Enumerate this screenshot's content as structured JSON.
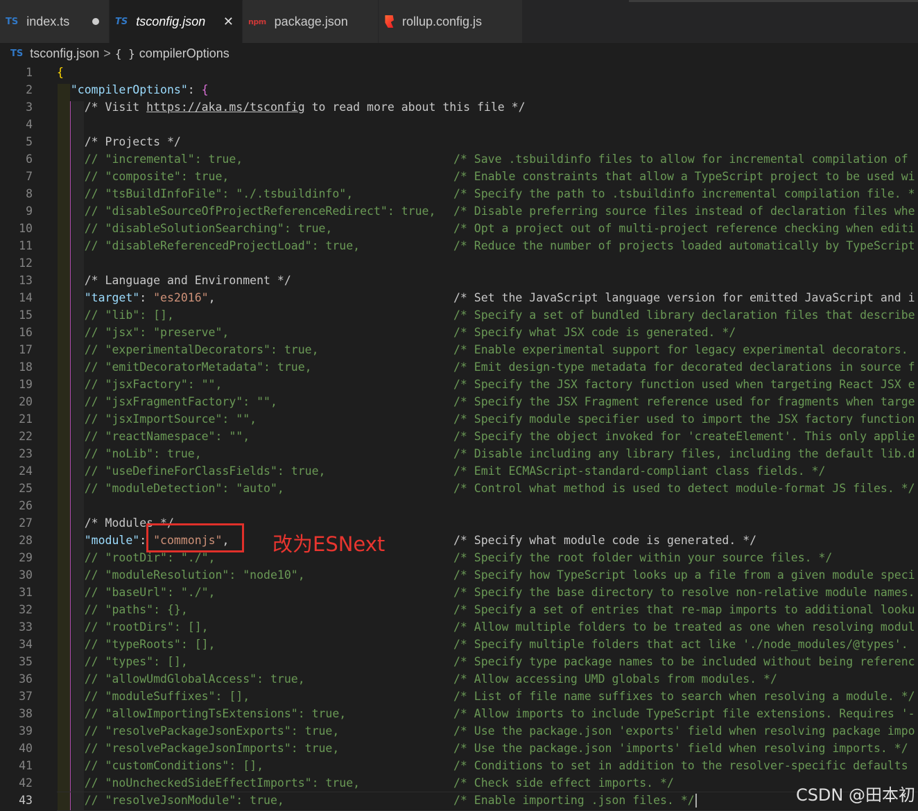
{
  "tabs": [
    {
      "icon": "TS",
      "label": "index.ts",
      "state": "modified"
    },
    {
      "icon": "TS",
      "label": "tsconfig.json",
      "state": "active"
    },
    {
      "icon": "npm",
      "label": "package.json",
      "state": ""
    },
    {
      "icon": "rollup",
      "label": "rollup.config.js",
      "state": ""
    }
  ],
  "breadcrumb": {
    "file": "tsconfig.json",
    "separator": ">",
    "symbol_icon": "{ }",
    "symbol": "compilerOptions"
  },
  "editor": {
    "current_line": 43,
    "lines": [
      {
        "n": "1",
        "code": [
          [
            "tk-brace",
            "{"
          ]
        ],
        "comment": ""
      },
      {
        "n": "2",
        "code": [
          [
            "tk-pun",
            "  "
          ],
          [
            "tk-key",
            "\"compilerOptions\""
          ],
          [
            "tk-pun",
            ": "
          ],
          [
            "tk-brace2",
            "{"
          ]
        ],
        "comment": ""
      },
      {
        "n": "3",
        "code": [
          [
            "tk-pun",
            "    "
          ],
          [
            "tk-gray",
            "/* Visit "
          ],
          [
            "tk-link",
            "https://aka.ms/tsconfig"
          ],
          [
            "tk-gray",
            " to read more about this file */"
          ]
        ],
        "comment": ""
      },
      {
        "n": "4",
        "code": [],
        "comment": ""
      },
      {
        "n": "5",
        "code": [
          [
            "tk-pun",
            "    "
          ],
          [
            "tk-gray",
            "/* Projects */"
          ]
        ],
        "comment": ""
      },
      {
        "n": "6",
        "code": [
          [
            "tk-pun",
            "    "
          ],
          [
            "tk-com",
            "// \"incremental\": true,"
          ]
        ],
        "comment": "/* Save .tsbuildinfo files to allow for incremental compilation of"
      },
      {
        "n": "7",
        "code": [
          [
            "tk-pun",
            "    "
          ],
          [
            "tk-com",
            "// \"composite\": true,"
          ]
        ],
        "comment": "/* Enable constraints that allow a TypeScript project to be used wi"
      },
      {
        "n": "8",
        "code": [
          [
            "tk-pun",
            "    "
          ],
          [
            "tk-com",
            "// \"tsBuildInfoFile\": \"./.tsbuildinfo\","
          ]
        ],
        "comment": "/* Specify the path to .tsbuildinfo incremental compilation file. *"
      },
      {
        "n": "9",
        "code": [
          [
            "tk-pun",
            "    "
          ],
          [
            "tk-com",
            "// \"disableSourceOfProjectReferenceRedirect\": true,"
          ]
        ],
        "comment": "/* Disable preferring source files instead of declaration files whe"
      },
      {
        "n": "10",
        "code": [
          [
            "tk-pun",
            "    "
          ],
          [
            "tk-com",
            "// \"disableSolutionSearching\": true,"
          ]
        ],
        "comment": "/* Opt a project out of multi-project reference checking when editi"
      },
      {
        "n": "11",
        "code": [
          [
            "tk-pun",
            "    "
          ],
          [
            "tk-com",
            "// \"disableReferencedProjectLoad\": true,"
          ]
        ],
        "comment": "/* Reduce the number of projects loaded automatically by TypeScript"
      },
      {
        "n": "12",
        "code": [],
        "comment": ""
      },
      {
        "n": "13",
        "code": [
          [
            "tk-pun",
            "    "
          ],
          [
            "tk-gray",
            "/* Language and Environment */"
          ]
        ],
        "comment": ""
      },
      {
        "n": "14",
        "code": [
          [
            "tk-pun",
            "    "
          ],
          [
            "tk-key",
            "\"target\""
          ],
          [
            "tk-pun",
            ": "
          ],
          [
            "tk-str",
            "\"es2016\""
          ],
          [
            "tk-pun",
            ","
          ]
        ],
        "comment": "/* Set the JavaScript language version for emitted JavaScript and i",
        "commentClass": "tk-gray"
      },
      {
        "n": "15",
        "code": [
          [
            "tk-pun",
            "    "
          ],
          [
            "tk-com",
            "// \"lib\": [],"
          ]
        ],
        "comment": "/* Specify a set of bundled library declaration files that describe"
      },
      {
        "n": "16",
        "code": [
          [
            "tk-pun",
            "    "
          ],
          [
            "tk-com",
            "// \"jsx\": \"preserve\","
          ]
        ],
        "comment": "/* Specify what JSX code is generated. */"
      },
      {
        "n": "17",
        "code": [
          [
            "tk-pun",
            "    "
          ],
          [
            "tk-com",
            "// \"experimentalDecorators\": true,"
          ]
        ],
        "comment": "/* Enable experimental support for legacy experimental decorators."
      },
      {
        "n": "18",
        "code": [
          [
            "tk-pun",
            "    "
          ],
          [
            "tk-com",
            "// \"emitDecoratorMetadata\": true,"
          ]
        ],
        "comment": "/* Emit design-type metadata for decorated declarations in source f"
      },
      {
        "n": "19",
        "code": [
          [
            "tk-pun",
            "    "
          ],
          [
            "tk-com",
            "// \"jsxFactory\": \"\","
          ]
        ],
        "comment": "/* Specify the JSX factory function used when targeting React JSX e"
      },
      {
        "n": "20",
        "code": [
          [
            "tk-pun",
            "    "
          ],
          [
            "tk-com",
            "// \"jsxFragmentFactory\": \"\","
          ]
        ],
        "comment": "/* Specify the JSX Fragment reference used for fragments when targe"
      },
      {
        "n": "21",
        "code": [
          [
            "tk-pun",
            "    "
          ],
          [
            "tk-com",
            "// \"jsxImportSource\": \"\","
          ]
        ],
        "comment": "/* Specify module specifier used to import the JSX factory function"
      },
      {
        "n": "22",
        "code": [
          [
            "tk-pun",
            "    "
          ],
          [
            "tk-com",
            "// \"reactNamespace\": \"\","
          ]
        ],
        "comment": "/* Specify the object invoked for 'createElement'. This only applie"
      },
      {
        "n": "23",
        "code": [
          [
            "tk-pun",
            "    "
          ],
          [
            "tk-com",
            "// \"noLib\": true,"
          ]
        ],
        "comment": "/* Disable including any library files, including the default lib.d"
      },
      {
        "n": "24",
        "code": [
          [
            "tk-pun",
            "    "
          ],
          [
            "tk-com",
            "// \"useDefineForClassFields\": true,"
          ]
        ],
        "comment": "/* Emit ECMAScript-standard-compliant class fields. */"
      },
      {
        "n": "25",
        "code": [
          [
            "tk-pun",
            "    "
          ],
          [
            "tk-com",
            "// \"moduleDetection\": \"auto\","
          ]
        ],
        "comment": "/* Control what method is used to detect module-format JS files. */"
      },
      {
        "n": "26",
        "code": [],
        "comment": ""
      },
      {
        "n": "27",
        "code": [
          [
            "tk-pun",
            "    "
          ],
          [
            "tk-gray",
            "/* Modules */"
          ]
        ],
        "comment": ""
      },
      {
        "n": "28",
        "code": [
          [
            "tk-pun",
            "    "
          ],
          [
            "tk-key",
            "\"module\""
          ],
          [
            "tk-pun",
            ": "
          ],
          [
            "tk-str",
            "\"commonjs\""
          ],
          [
            "tk-pun",
            ","
          ]
        ],
        "comment": "/* Specify what module code is generated. */",
        "commentClass": "tk-gray"
      },
      {
        "n": "29",
        "code": [
          [
            "tk-pun",
            "    "
          ],
          [
            "tk-com",
            "// \"rootDir\": \"./\","
          ]
        ],
        "comment": "/* Specify the root folder within your source files. */"
      },
      {
        "n": "30",
        "code": [
          [
            "tk-pun",
            "    "
          ],
          [
            "tk-com",
            "// \"moduleResolution\": \"node10\","
          ]
        ],
        "comment": "/* Specify how TypeScript looks up a file from a given module speci"
      },
      {
        "n": "31",
        "code": [
          [
            "tk-pun",
            "    "
          ],
          [
            "tk-com",
            "// \"baseUrl\": \"./\","
          ]
        ],
        "comment": "/* Specify the base directory to resolve non-relative module names."
      },
      {
        "n": "32",
        "code": [
          [
            "tk-pun",
            "    "
          ],
          [
            "tk-com",
            "// \"paths\": {},"
          ]
        ],
        "comment": "/* Specify a set of entries that re-map imports to additional looku"
      },
      {
        "n": "33",
        "code": [
          [
            "tk-pun",
            "    "
          ],
          [
            "tk-com",
            "// \"rootDirs\": [],"
          ]
        ],
        "comment": "/* Allow multiple folders to be treated as one when resolving modul"
      },
      {
        "n": "34",
        "code": [
          [
            "tk-pun",
            "    "
          ],
          [
            "tk-com",
            "// \"typeRoots\": [],"
          ]
        ],
        "comment": "/* Specify multiple folders that act like './node_modules/@types'."
      },
      {
        "n": "35",
        "code": [
          [
            "tk-pun",
            "    "
          ],
          [
            "tk-com",
            "// \"types\": [],"
          ]
        ],
        "comment": "/* Specify type package names to be included without being referenc"
      },
      {
        "n": "36",
        "code": [
          [
            "tk-pun",
            "    "
          ],
          [
            "tk-com",
            "// \"allowUmdGlobalAccess\": true,"
          ]
        ],
        "comment": "/* Allow accessing UMD globals from modules. */"
      },
      {
        "n": "37",
        "code": [
          [
            "tk-pun",
            "    "
          ],
          [
            "tk-com",
            "// \"moduleSuffixes\": [],"
          ]
        ],
        "comment": "/* List of file name suffixes to search when resolving a module. */"
      },
      {
        "n": "38",
        "code": [
          [
            "tk-pun",
            "    "
          ],
          [
            "tk-com",
            "// \"allowImportingTsExtensions\": true,"
          ]
        ],
        "comment": "/* Allow imports to include TypeScript file extensions. Requires '-"
      },
      {
        "n": "39",
        "code": [
          [
            "tk-pun",
            "    "
          ],
          [
            "tk-com",
            "// \"resolvePackageJsonExports\": true,"
          ]
        ],
        "comment": "/* Use the package.json 'exports' field when resolving package impo"
      },
      {
        "n": "40",
        "code": [
          [
            "tk-pun",
            "    "
          ],
          [
            "tk-com",
            "// \"resolvePackageJsonImports\": true,"
          ]
        ],
        "comment": "/* Use the package.json 'imports' field when resolving imports. */"
      },
      {
        "n": "41",
        "code": [
          [
            "tk-pun",
            "    "
          ],
          [
            "tk-com",
            "// \"customConditions\": [],"
          ]
        ],
        "comment": "/* Conditions to set in addition to the resolver-specific defaults"
      },
      {
        "n": "42",
        "code": [
          [
            "tk-pun",
            "    "
          ],
          [
            "tk-com",
            "// \"noUncheckedSideEffectImports\": true,"
          ]
        ],
        "comment": "/* Check side effect imports. */"
      },
      {
        "n": "43",
        "code": [
          [
            "tk-pun",
            "    "
          ],
          [
            "tk-com",
            "// \"resolveJsonModule\": true,"
          ]
        ],
        "comment": "/* Enable importing .json files. */"
      }
    ]
  },
  "annotation": {
    "text": "改为ESNext",
    "color": "#e8352f"
  },
  "watermark": "CSDN @田本初",
  "colors": {
    "background": "#1e1e1e",
    "tab_bar": "#252526",
    "comment": "#6a9955",
    "key": "#9cdcfe",
    "string": "#ce9178",
    "brace": "#ffd700",
    "highlight_box": "#e0302a"
  }
}
